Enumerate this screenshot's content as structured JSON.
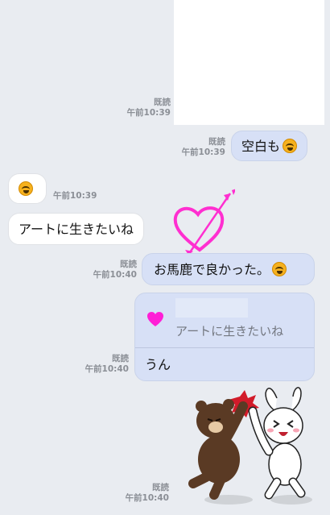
{
  "messages": {
    "image_msg": {
      "read": "既読",
      "time": "午前10:39"
    },
    "blank_msg": {
      "text": "空白も",
      "read": "既読",
      "time": "午前10:39"
    },
    "emoji_msg": {
      "time": "午前10:39"
    },
    "art_msg": {
      "text": "アートに生きたいね"
    },
    "idiot_msg": {
      "text": "お馬鹿で良かった。",
      "read": "既読",
      "time": "午前10:40"
    },
    "reply_msg": {
      "quoted_text": "アートに生きたいね",
      "text": "うん",
      "read": "既読",
      "time": "午前10:40"
    },
    "sticker_msg": {
      "read": "既読",
      "time": "午前10:40"
    }
  },
  "icons": {
    "emoji": "laughing-tears-emoji-icon",
    "heart_overlay": "heart-arrow-icon",
    "reply_heart": "heart-icon",
    "sticker": "brown-cony-highfive-sticker"
  },
  "colors": {
    "background": "#e9ecf1",
    "outgoing_bubble": "#d7e0f6",
    "incoming_bubble": "#ffffff",
    "heart": "#ff2fd0"
  }
}
